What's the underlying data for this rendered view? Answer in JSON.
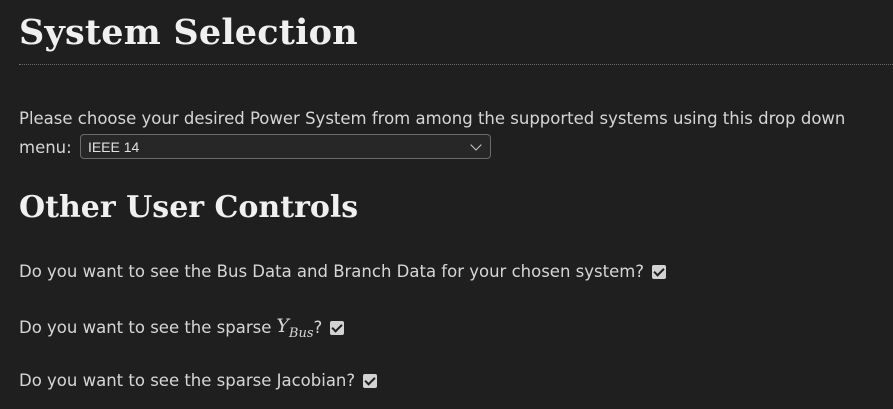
{
  "system_selection": {
    "heading": "System Selection",
    "intro_text": "Please choose your desired Power System from among the supported systems using this drop down menu:",
    "dropdown": {
      "selected": "IEEE 14"
    }
  },
  "other_controls": {
    "heading": "Other User Controls",
    "items": [
      {
        "question": "Do you want to see the Bus Data and Branch Data for your chosen system?",
        "checked": true
      },
      {
        "question_prefix": "Do you want to see the sparse",
        "math_main": "Y",
        "math_sub": "Bus",
        "question_suffix": "?",
        "checked": true
      },
      {
        "question": "Do you want to see the sparse Jacobian?",
        "checked": true
      }
    ]
  }
}
